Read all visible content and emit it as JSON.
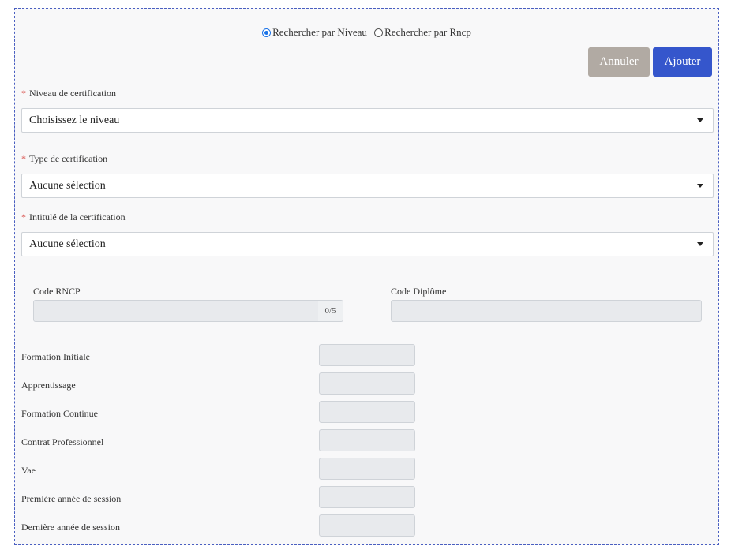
{
  "search_mode": {
    "options": [
      {
        "label": "Rechercher par Niveau",
        "checked": true
      },
      {
        "label": "Rechercher par Rncp",
        "checked": false
      }
    ]
  },
  "actions": {
    "cancel_label": "Annuler",
    "add_label": "Ajouter"
  },
  "fields": {
    "niveau": {
      "label": "Niveau de certification",
      "required": "*",
      "value": "Choisissez le niveau"
    },
    "type": {
      "label": "Type de certification",
      "required": "*",
      "value": "Aucune sélection"
    },
    "intitule": {
      "label": "Intitulé de la certification",
      "required": "*",
      "value": "Aucune sélection"
    }
  },
  "codes": {
    "rncp_label": "Code RNCP",
    "rncp_counter": "0/5",
    "diplome_label": "Code Diplôme"
  },
  "formation_rows": [
    {
      "label": "Formation Initiale"
    },
    {
      "label": "Apprentissage"
    },
    {
      "label": "Formation Continue"
    },
    {
      "label": "Contrat Professionnel"
    },
    {
      "label": "Vae"
    },
    {
      "label": "Première année de session"
    },
    {
      "label": "Dernière année de session"
    }
  ],
  "colors": {
    "accent": "#3556cc",
    "cancel": "#b1aaa3",
    "required": "#d9534f",
    "border_dashed": "#4a5fc1"
  }
}
